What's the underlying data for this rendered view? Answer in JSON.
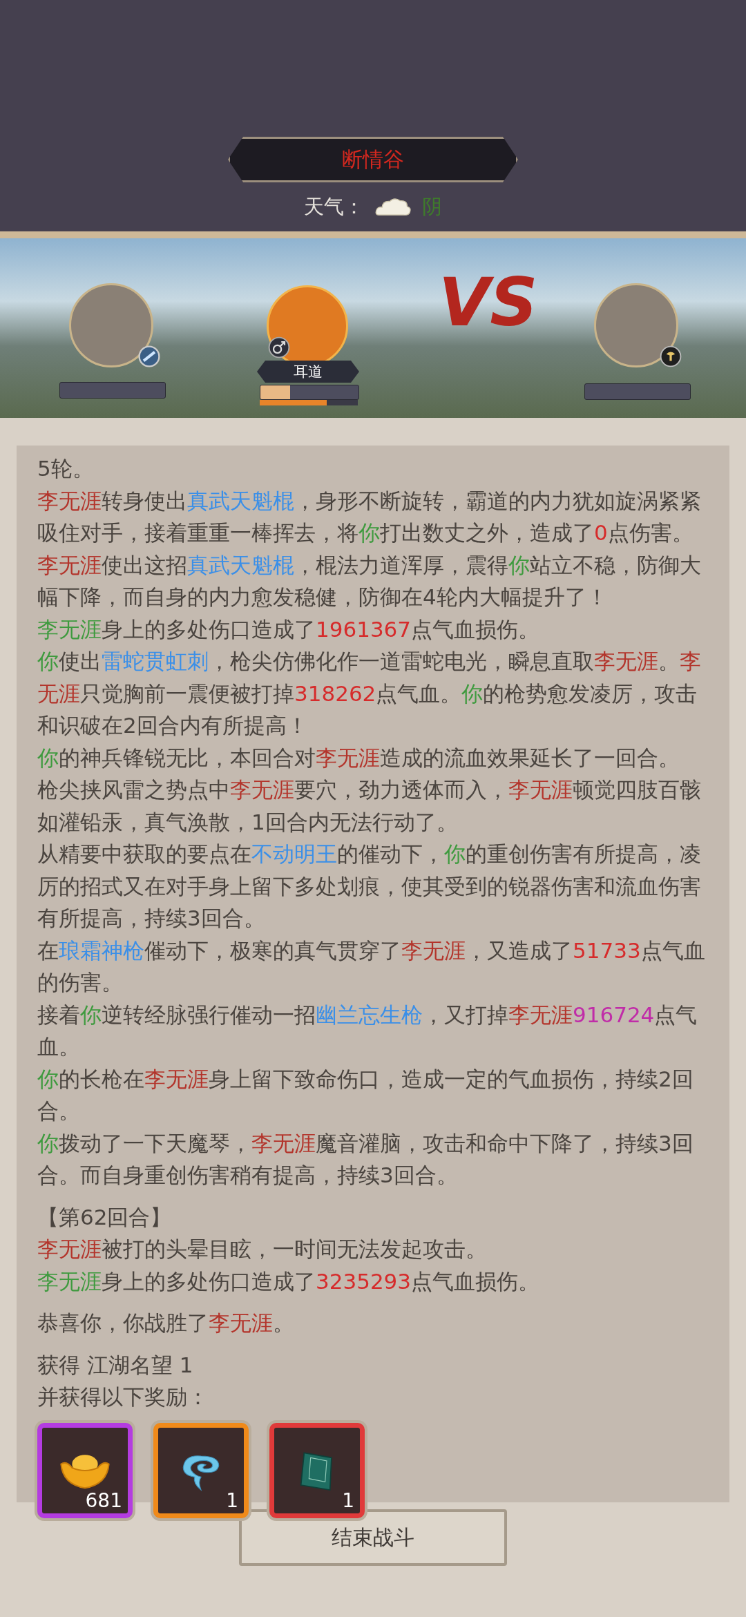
{
  "header": {
    "location": "断情谷",
    "weather_label": "天气：",
    "weather": "阴"
  },
  "battle": {
    "versus": "VS",
    "companion": {
      "name": "耳道",
      "hp": {
        "level": 0.3
      },
      "rage": {
        "level": 0.68
      }
    }
  },
  "log_sections": [
    [
      {
        "segments": [
          {
            "kind": "plain",
            "text": "5轮。"
          }
        ]
      },
      {
        "segments": [
          {
            "kind": "enemy",
            "text": "李无涯"
          },
          {
            "kind": "plain",
            "text": "转身使出"
          },
          {
            "kind": "skill",
            "text": "真武天魁棍"
          },
          {
            "kind": "plain",
            "text": "，身形不断旋转，霸道的内力犹如旋涡紧紧吸住对手，接着重重一棒挥去，将"
          },
          {
            "kind": "you",
            "text": "你"
          },
          {
            "kind": "plain",
            "text": "打出数丈之外，造成了"
          },
          {
            "kind": "damage",
            "text": "0"
          },
          {
            "kind": "plain",
            "text": "点伤害。"
          }
        ]
      },
      {
        "segments": [
          {
            "kind": "enemy",
            "text": "李无涯"
          },
          {
            "kind": "plain",
            "text": "使出这招"
          },
          {
            "kind": "skill",
            "text": "真武天魁棍"
          },
          {
            "kind": "plain",
            "text": "，棍法力道浑厚，震得"
          },
          {
            "kind": "you",
            "text": "你"
          },
          {
            "kind": "plain",
            "text": "站立不稳，防御大幅下降，而自身的内力愈发稳健，防御在4轮内大幅提升了！"
          }
        ]
      },
      {
        "segments": [
          {
            "kind": "bleed",
            "text": "李无涯"
          },
          {
            "kind": "plain",
            "text": "身上的多处伤口造成了"
          },
          {
            "kind": "damage",
            "text": "1961367"
          },
          {
            "kind": "plain",
            "text": "点气血损伤。"
          }
        ]
      },
      {
        "segments": [
          {
            "kind": "you",
            "text": "你"
          },
          {
            "kind": "plain",
            "text": "使出"
          },
          {
            "kind": "skill",
            "text": "雷蛇贯虹刺"
          },
          {
            "kind": "plain",
            "text": "，枪尖仿佛化作一道雷蛇电光，瞬息直取"
          },
          {
            "kind": "enemy",
            "text": "李无涯"
          },
          {
            "kind": "plain",
            "text": "。"
          },
          {
            "kind": "enemy",
            "text": "李无涯"
          },
          {
            "kind": "plain",
            "text": "只觉胸前一震便被打掉"
          },
          {
            "kind": "damage",
            "text": "318262"
          },
          {
            "kind": "plain",
            "text": "点气血。"
          },
          {
            "kind": "you",
            "text": "你"
          },
          {
            "kind": "plain",
            "text": "的枪势愈发凌厉，攻击和识破在2回合内有所提高！"
          }
        ]
      },
      {
        "segments": [
          {
            "kind": "you",
            "text": "你"
          },
          {
            "kind": "plain",
            "text": "的神兵锋锐无比，本回合对"
          },
          {
            "kind": "enemy",
            "text": "李无涯"
          },
          {
            "kind": "plain",
            "text": "造成的流血效果延长了一回合。"
          }
        ]
      },
      {
        "segments": [
          {
            "kind": "plain",
            "text": "枪尖挟风雷之势点中"
          },
          {
            "kind": "enemy",
            "text": "李无涯"
          },
          {
            "kind": "plain",
            "text": "要穴，劲力透体而入，"
          },
          {
            "kind": "enemy",
            "text": "李无涯"
          },
          {
            "kind": "plain",
            "text": "顿觉四肢百骸如灌铅汞，真气涣散，1回合内无法行动了。"
          }
        ]
      },
      {
        "segments": [
          {
            "kind": "plain",
            "text": "从精要中获取的要点在"
          },
          {
            "kind": "skill",
            "text": "不动明王"
          },
          {
            "kind": "plain",
            "text": "的催动下，"
          },
          {
            "kind": "you",
            "text": "你"
          },
          {
            "kind": "plain",
            "text": "的重创伤害有所提高，凌厉的招式又在对手身上留下多处划痕，使其受到的锐器伤害和流血伤害有所提高，持续3回合。"
          }
        ]
      },
      {
        "segments": [
          {
            "kind": "plain",
            "text": "在"
          },
          {
            "kind": "skill",
            "text": "琅霜神枪"
          },
          {
            "kind": "plain",
            "text": "催动下，极寒的真气贯穿了"
          },
          {
            "kind": "enemy",
            "text": "李无涯"
          },
          {
            "kind": "plain",
            "text": "，又造成了"
          },
          {
            "kind": "damage",
            "text": "51733"
          },
          {
            "kind": "plain",
            "text": "点气血的伤害。"
          }
        ]
      },
      {
        "segments": [
          {
            "kind": "plain",
            "text": "接着"
          },
          {
            "kind": "you",
            "text": "你"
          },
          {
            "kind": "plain",
            "text": "逆转经脉强行催动一招"
          },
          {
            "kind": "skill",
            "text": "幽兰忘生枪"
          },
          {
            "kind": "plain",
            "text": "，又打掉"
          },
          {
            "kind": "enemy",
            "text": "李无涯"
          },
          {
            "kind": "crit",
            "text": "916724"
          },
          {
            "kind": "plain",
            "text": "点气血。"
          }
        ]
      },
      {
        "segments": [
          {
            "kind": "you",
            "text": "你"
          },
          {
            "kind": "plain",
            "text": "的长枪在"
          },
          {
            "kind": "enemy",
            "text": "李无涯"
          },
          {
            "kind": "plain",
            "text": "身上留下致命伤口，造成一定的气血损伤，持续2回合。"
          }
        ]
      },
      {
        "segments": [
          {
            "kind": "you",
            "text": "你"
          },
          {
            "kind": "plain",
            "text": "拨动了一下天魔琴，"
          },
          {
            "kind": "enemy",
            "text": "李无涯"
          },
          {
            "kind": "plain",
            "text": "魔音灌脑，攻击和命中下降了，持续3回合。而自身重创伤害稍有提高，持续3回合。"
          }
        ]
      }
    ],
    [
      {
        "segments": [
          {
            "kind": "plain",
            "text": "【第62回合】"
          }
        ]
      },
      {
        "segments": [
          {
            "kind": "enemy",
            "text": "李无涯"
          },
          {
            "kind": "plain",
            "text": "被打的头晕目眩，一时间无法发起攻击。"
          }
        ]
      },
      {
        "segments": [
          {
            "kind": "bleed",
            "text": "李无涯"
          },
          {
            "kind": "plain",
            "text": "身上的多处伤口造成了"
          },
          {
            "kind": "damage",
            "text": "3235293"
          },
          {
            "kind": "plain",
            "text": "点气血损伤。"
          }
        ]
      }
    ],
    [
      {
        "segments": [
          {
            "kind": "plain",
            "text": "恭喜你，你战胜了"
          },
          {
            "kind": "enemy",
            "text": "李无涯"
          },
          {
            "kind": "plain",
            "text": "。"
          }
        ]
      }
    ],
    [
      {
        "segments": [
          {
            "kind": "plain",
            "text": "获得 江湖名望 1"
          }
        ]
      },
      {
        "segments": [
          {
            "kind": "plain",
            "text": "并获得以下奖励："
          }
        ]
      }
    ]
  ],
  "rewards": [
    {
      "kind": "ingot",
      "count": "681",
      "color": "#b43ce0"
    },
    {
      "kind": "cloud",
      "count": "1",
      "color": "#f08a1a"
    },
    {
      "kind": "book",
      "count": "1",
      "color": "#e03a3a"
    }
  ],
  "end_button": "结束战斗"
}
